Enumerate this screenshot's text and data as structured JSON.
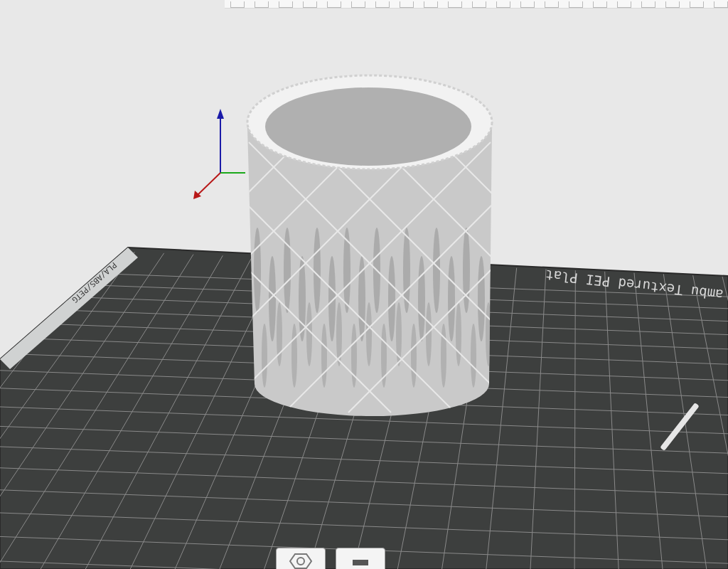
{
  "viewport": {
    "plate_label": "ambu Textured PEI Plat",
    "plate_side_label": "PLA/ABS/PETG"
  }
}
